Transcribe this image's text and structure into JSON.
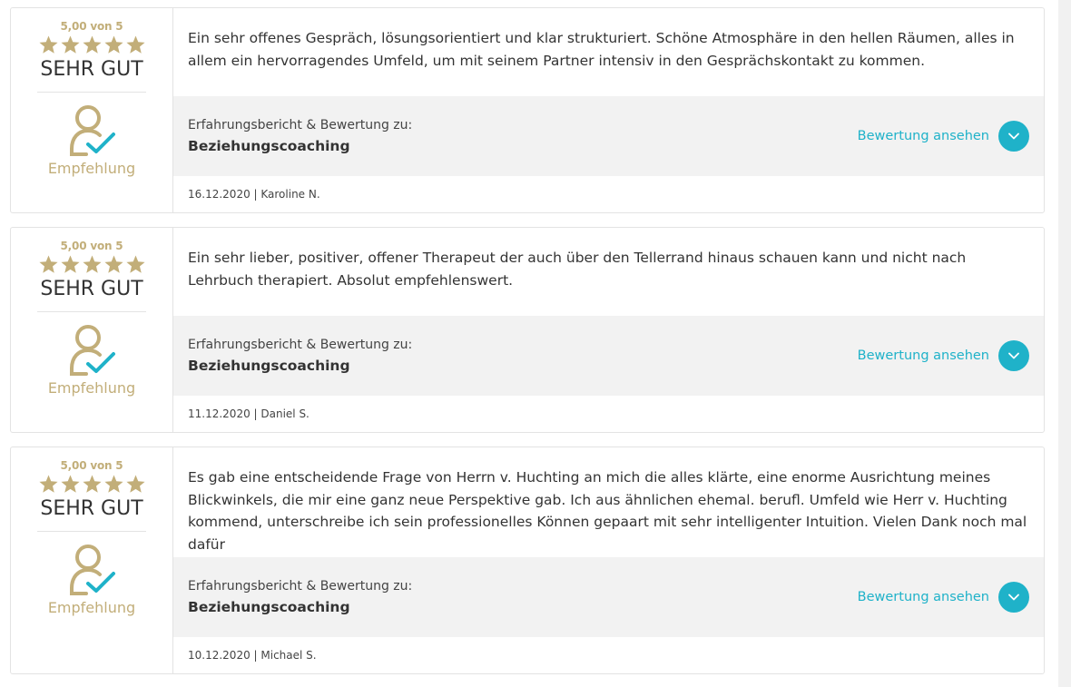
{
  "colors": {
    "gold": "#c2ae79",
    "accent": "#1fb2c9",
    "border": "#e3e3e3",
    "panel_bg": "#f2f2f2"
  },
  "reviews": [
    {
      "score": "5,00 von 5",
      "stars": 5,
      "rating_word": "SEHR GUT",
      "recommendation": "Empfehlung",
      "recommendation_icon": "user-check-icon",
      "text": "Ein sehr offenes Gespräch, lösungsorientiert und klar strukturiert. Schöne Atmosphäre in den hellen Räumen, alles in allem ein hervorragendes Umfeld, um mit seinem Partner intensiv in den Gesprächskontakt zu kommen.",
      "service_label": "Erfahrungsbericht & Bewertung zu:",
      "service_name": "Beziehungscoaching",
      "view_label": "Bewertung ansehen",
      "view_icon": "chevron-down-icon",
      "meta": "16.12.2020 | Karoline N."
    },
    {
      "score": "5,00 von 5",
      "stars": 5,
      "rating_word": "SEHR GUT",
      "recommendation": "Empfehlung",
      "recommendation_icon": "user-check-icon",
      "text": "Ein sehr lieber, positiver, offener Therapeut der auch über den Tellerrand hinaus schauen kann und nicht nach Lehrbuch therapiert. Absolut empfehlenswert.",
      "service_label": "Erfahrungsbericht & Bewertung zu:",
      "service_name": "Beziehungscoaching",
      "view_label": "Bewertung ansehen",
      "view_icon": "chevron-down-icon",
      "meta": "11.12.2020 | Daniel S."
    },
    {
      "score": "5,00 von 5",
      "stars": 5,
      "rating_word": "SEHR GUT",
      "recommendation": "Empfehlung",
      "recommendation_icon": "user-check-icon",
      "text": "Es gab eine entscheidende Frage von Herrn v. Huchting an mich die alles klärte, eine enorme Ausrichtung meines Blickwinkels, die mir eine ganz neue Perspektive gab. Ich aus ähnlichen ehemal. berufl. Umfeld wie Herr v. Huchting kommend, unterschreibe ich sein professionelles Können gepaart mit sehr intelligenter Intuition. Vielen Dank noch mal dafür",
      "service_label": "Erfahrungsbericht & Bewertung zu:",
      "service_name": "Beziehungscoaching",
      "view_label": "Bewertung ansehen",
      "view_icon": "chevron-down-icon",
      "meta": "10.12.2020 | Michael S."
    }
  ]
}
